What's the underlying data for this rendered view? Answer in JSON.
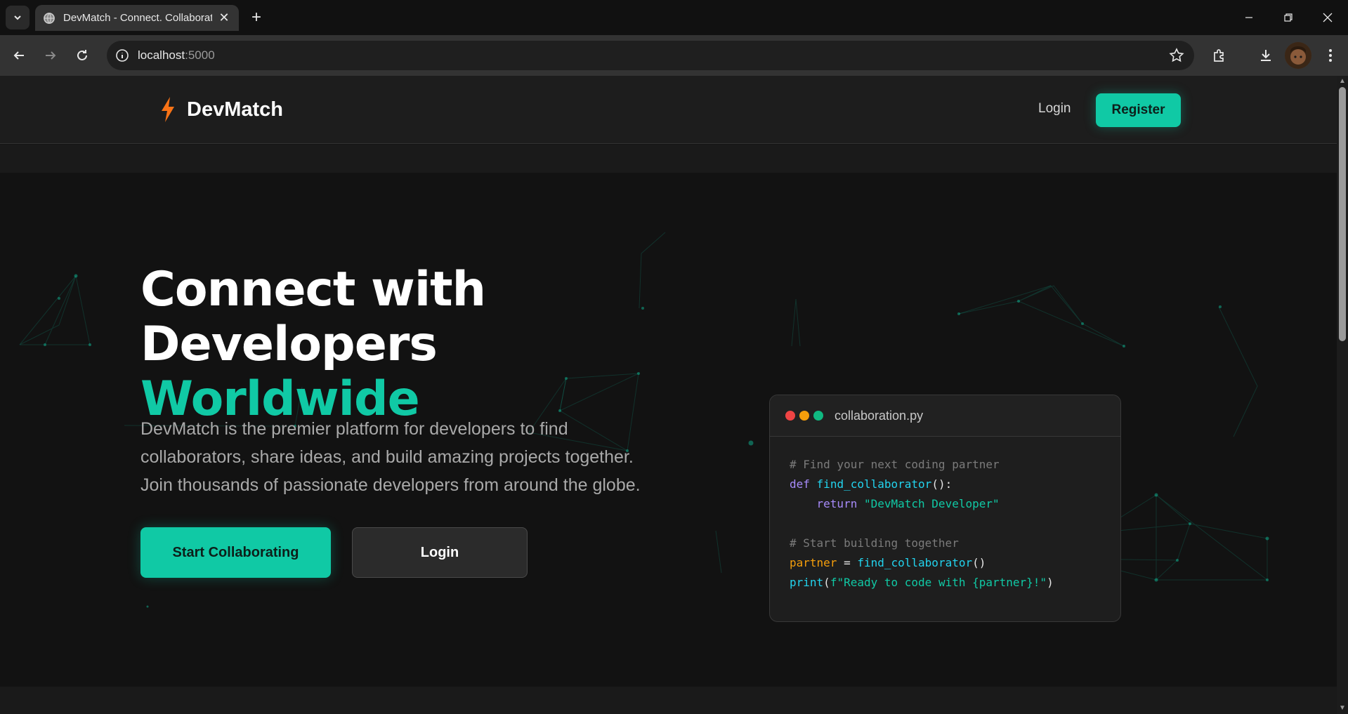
{
  "browser": {
    "tab_title": "DevMatch - Connect. Collaborate",
    "url_host": "localhost",
    "url_port": ":5000"
  },
  "header": {
    "brand": "DevMatch",
    "login_label": "Login",
    "register_label": "Register"
  },
  "hero": {
    "title_line1": "Connect with",
    "title_line2": "Developers",
    "title_accent": "Worldwide",
    "description": "DevMatch is the premier platform for developers to find collaborators, share ideas, and build amazing projects together. Join thousands of passionate developers from around the globe.",
    "primary_button": "Start Collaborating",
    "secondary_button": "Login"
  },
  "code_card": {
    "filename": "collaboration.py",
    "lines": {
      "l1_comment": "# Find your next coding partner",
      "l2_kw": "def",
      "l2_fn": "find_collaborator",
      "l2_rest": "():",
      "l3_kw": "return",
      "l3_str": "\"DevMatch Developer\"",
      "l5_comment": "# Start building together",
      "l6_var": "partner",
      "l6_eq": " = ",
      "l6_fn": "find_collaborator",
      "l6_rest": "()",
      "l7_fn": "print",
      "l7_open": "(",
      "l7_str": "f\"Ready to code with {partner}!\"",
      "l7_close": ")"
    }
  },
  "colors": {
    "accent": "#10c9a5",
    "logo_bolt": "#f97316",
    "dot_red": "#ef4444",
    "dot_yellow": "#f59e0b",
    "dot_green": "#10b981"
  }
}
